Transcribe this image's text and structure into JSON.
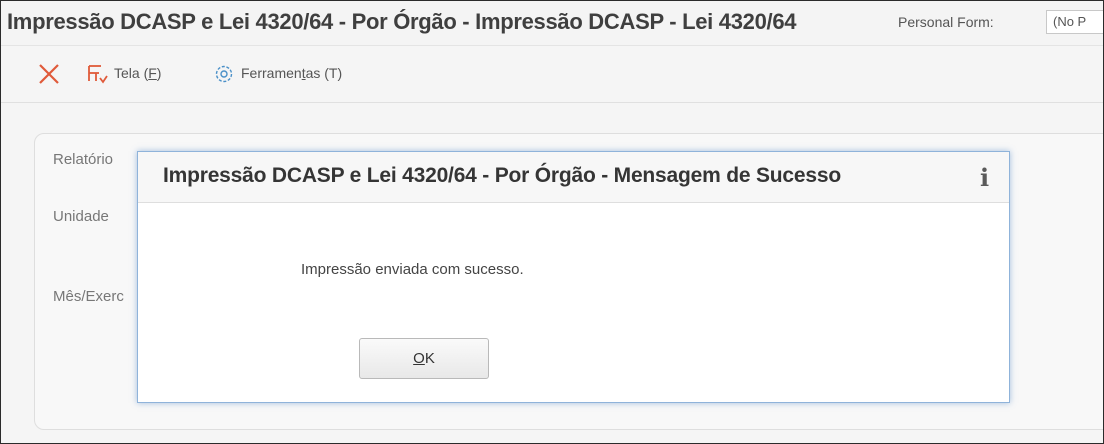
{
  "header": {
    "title": "Impressão DCASP e Lei 4320/64 - Por Órgão - Impressão DCASP - Lei 4320/64",
    "personal_form_label": "Personal Form:",
    "personal_form_value": "(No P"
  },
  "toolbar": {
    "tela_main": "Tela (",
    "tela_key": "F",
    "tela_end": ")",
    "tools_main": "Ferramen",
    "tools_key": "t",
    "tools_end": "as (T)"
  },
  "form": {
    "labels": [
      "Relatório",
      "Unidade",
      "Mês/Exerc"
    ]
  },
  "dialog": {
    "title": "Impressão DCASP e Lei 4320/64 - Por Órgão - Mensagem de Sucesso",
    "info_icon": "i",
    "message": "Impressão enviada com sucesso.",
    "ok_key": "O",
    "ok_rest": "K"
  },
  "colors": {
    "close_icon": "#e05a3a",
    "tela_icon": "#e05a3a",
    "tools_icon": "#4a90c8",
    "dialog_border": "#8fb3da"
  },
  "icons": [
    "close-icon",
    "tela-icon",
    "gear-icon",
    "info-icon"
  ]
}
